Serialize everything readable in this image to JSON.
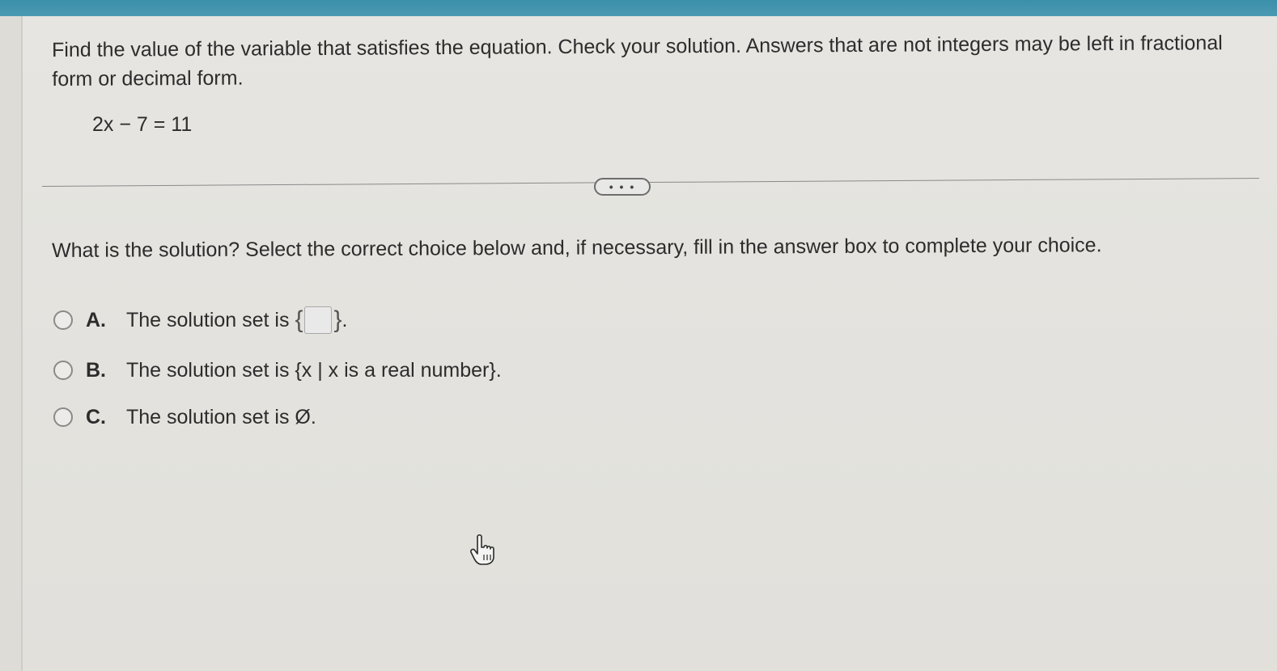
{
  "instructions": "Find the value of the variable that satisfies the equation. Check your solution. Answers that are not integers may be left in fractional form or decimal form.",
  "equation": "2x − 7 = 11",
  "expand_button": "• • •",
  "question": "What is the solution? Select the correct choice below and, if necessary, fill in the answer box to complete your choice.",
  "choices": [
    {
      "letter": "A.",
      "prefix": "The solution set is ",
      "open_brace": "{",
      "close_brace": "}",
      "suffix": "."
    },
    {
      "letter": "B.",
      "text": "The solution set is {x | x is a real number}."
    },
    {
      "letter": "C.",
      "text": "The solution set is Ø."
    }
  ],
  "icons": {
    "cursor": "hand-pointer-icon"
  }
}
